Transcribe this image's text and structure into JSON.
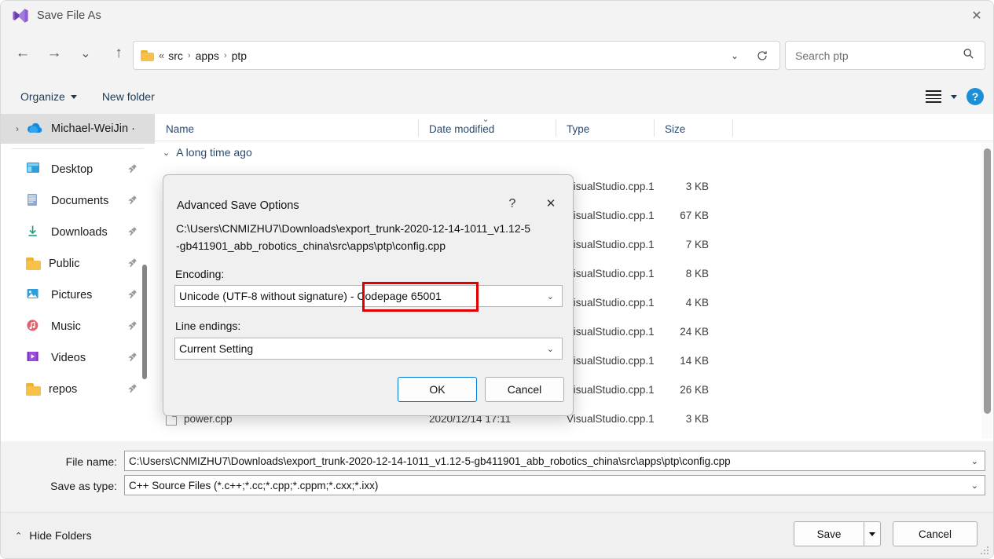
{
  "window": {
    "title": "Save File As",
    "app_icon": "visual-studio-icon",
    "close_label": "✕"
  },
  "nav": {
    "back_icon": "←",
    "forward_icon": "→",
    "recent_icon": "⌄",
    "up_icon": "↑",
    "address": {
      "folder_icon": "folder-icon",
      "overflow": "«",
      "crumbs": [
        "src",
        "apps",
        "ptp"
      ],
      "separator": "›",
      "dropdown_icon": "⌄",
      "refresh_icon": "↻"
    },
    "search": {
      "placeholder": "Search ptp",
      "value": "",
      "icon": "search-icon"
    }
  },
  "toolbar": {
    "organize_label": "Organize",
    "new_folder_label": "New folder",
    "view_icon": "list-view-icon",
    "view_caret": "▾",
    "help_label": "?"
  },
  "sidebar": {
    "root": {
      "chevron": "›",
      "label": "Michael-WeiJin ·",
      "icon": "onedrive-cloud-icon"
    },
    "items": [
      {
        "label": "Desktop",
        "icon": "desktop-icon",
        "pinned": true
      },
      {
        "label": "Documents",
        "icon": "documents-icon",
        "pinned": true
      },
      {
        "label": "Downloads",
        "icon": "downloads-icon",
        "pinned": true
      },
      {
        "label": "Public",
        "icon": "folder-icon",
        "pinned": true
      },
      {
        "label": "Pictures",
        "icon": "pictures-icon",
        "pinned": true
      },
      {
        "label": "Music",
        "icon": "music-icon",
        "pinned": true
      },
      {
        "label": "Videos",
        "icon": "videos-icon",
        "pinned": true
      },
      {
        "label": "repos",
        "icon": "folder-icon",
        "pinned": true
      }
    ],
    "pin_glyph": "📌"
  },
  "filelist": {
    "columns": [
      {
        "key": "name",
        "label": "Name"
      },
      {
        "key": "date",
        "label": "Date modified",
        "sorted": true,
        "sort_icon": "⌄"
      },
      {
        "key": "type",
        "label": "Type"
      },
      {
        "key": "size",
        "label": "Size"
      }
    ],
    "group": {
      "label": "A long time ago",
      "chevron": "⌄"
    },
    "rows": [
      {
        "name": "",
        "date": "",
        "type": "VisualStudio.cpp.1…",
        "size": "3 KB"
      },
      {
        "name": "",
        "date": "",
        "type": "VisualStudio.cpp.1…",
        "size": "67 KB"
      },
      {
        "name": "",
        "date": "",
        "type": "VisualStudio.cpp.1…",
        "size": "7 KB"
      },
      {
        "name": "",
        "date": "",
        "type": "VisualStudio.cpp.1…",
        "size": "8 KB"
      },
      {
        "name": "",
        "date": "",
        "type": "VisualStudio.cpp.1…",
        "size": "4 KB"
      },
      {
        "name": "",
        "date": "",
        "type": "VisualStudio.cpp.1…",
        "size": "24 KB"
      },
      {
        "name": "",
        "date": "",
        "type": "VisualStudio.cpp.1…",
        "size": "14 KB"
      },
      {
        "name": "",
        "date": "",
        "type": "VisualStudio.cpp.1…",
        "size": "26 KB"
      },
      {
        "name": "power.cpp",
        "date": "2020/12/14 17:11",
        "type": "VisualStudio.cpp.1",
        "size": "3 KB"
      }
    ]
  },
  "fields": {
    "file_name_label": "File name:",
    "file_name_value": "C:\\Users\\CNMIZHU7\\Downloads\\export_trunk-2020-12-14-1011_v1.12-5-gb411901_abb_robotics_china\\src\\apps\\ptp\\config.cpp",
    "save_as_type_label": "Save as type:",
    "save_as_type_value": "C++ Source Files (*.c++;*.cc;*.cpp;*.cppm;*.cxx;*.ixx)",
    "caret": "⌄"
  },
  "bottombar": {
    "hide_folders_label": "Hide Folders",
    "hide_folders_chevron": "⌃",
    "save_label": "Save",
    "cancel_label": "Cancel"
  },
  "dialog": {
    "title": "Advanced Save Options",
    "help_label": "?",
    "close_label": "✕",
    "path_line1": "C:\\Users\\CNMIZHU7\\Downloads\\export_trunk-2020-12-14-1011_v1.12-5",
    "path_line2": "-gb411901_abb_robotics_china\\src\\apps\\ptp\\config.cpp",
    "encoding_label": "Encoding:",
    "encoding_value": "Unicode (UTF-8 without signature) - Codepage 65001",
    "line_endings_label": "Line endings:",
    "line_endings_value": "Current Setting",
    "ok_label": "OK",
    "cancel_label": "Cancel",
    "caret": "⌄",
    "highlight_color": "#e00000",
    "highlight_text": "Codepage 65001"
  }
}
